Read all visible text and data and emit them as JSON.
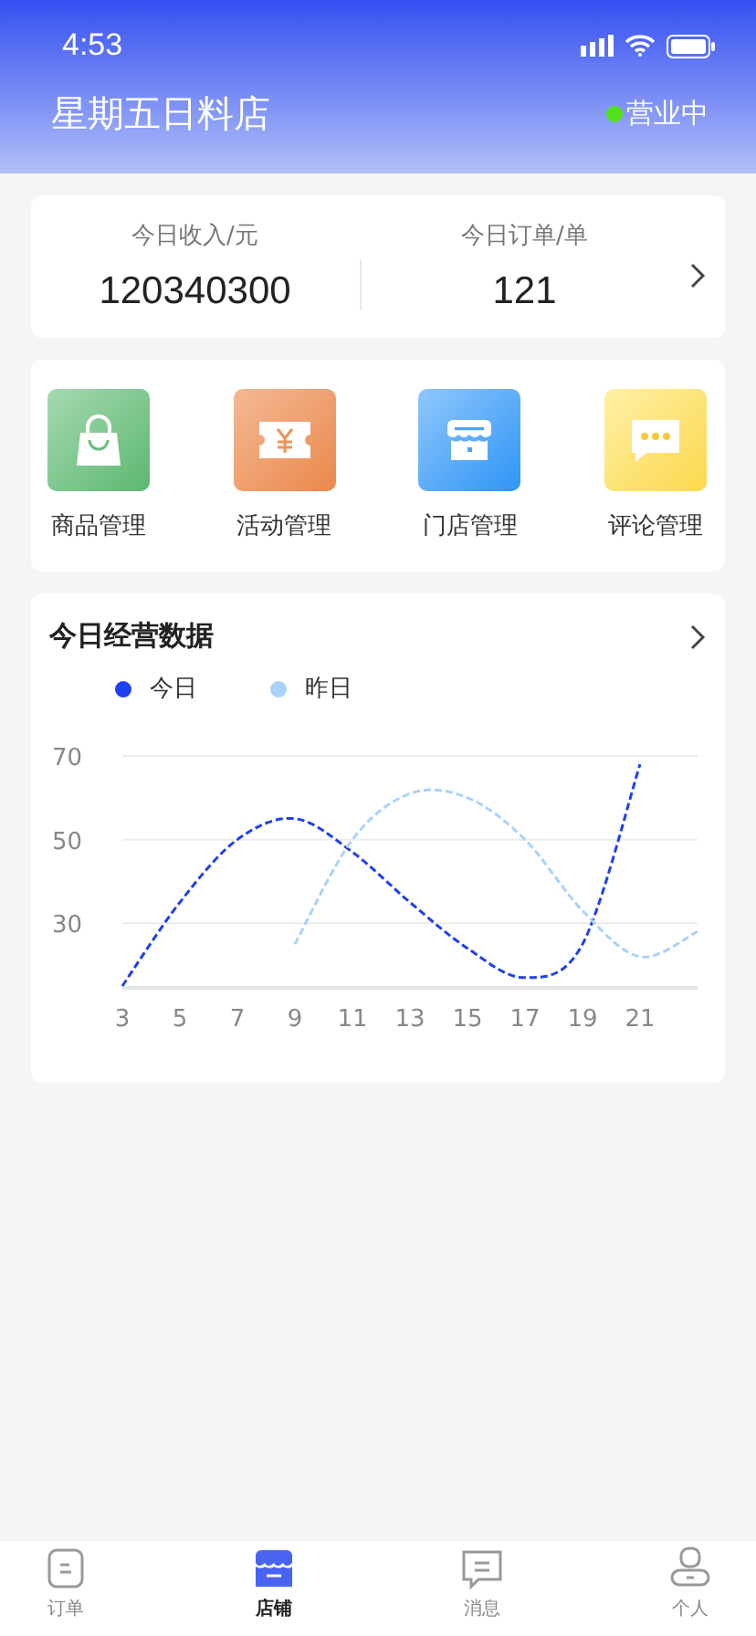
{
  "status_bar": {
    "time": "4:53"
  },
  "header": {
    "title": "星期五日料店",
    "status": {
      "label": "营业中",
      "color": "#52e01a"
    }
  },
  "stats": [
    {
      "label": "今日收入/元",
      "value": "120340300"
    },
    {
      "label": "今日订单/单",
      "value": "121"
    }
  ],
  "shortcuts": [
    {
      "label": "商品管理"
    },
    {
      "label": "活动管理"
    },
    {
      "label": "门店管理"
    },
    {
      "label": "评论管理"
    }
  ],
  "chart_section": {
    "title": "今日经营数据",
    "chart_data": {
      "type": "line",
      "x": [
        3,
        5,
        7,
        9,
        11,
        13,
        15,
        17,
        19,
        21,
        23
      ],
      "xlim": [
        3,
        23
      ],
      "ylim": [
        15,
        70
      ],
      "xticks": [
        3,
        5,
        7,
        9,
        11,
        13,
        15,
        17,
        19,
        21
      ],
      "yticks": [
        30,
        50,
        70
      ],
      "series": [
        {
          "name": "今日",
          "color": "#1f3ff0",
          "line_style": "dashed",
          "values": [
            15,
            35,
            50,
            55,
            47,
            35,
            24,
            17,
            25,
            68,
            null
          ]
        },
        {
          "name": "昨日",
          "color": "#a9d2fb",
          "line_style": "dashed",
          "values": [
            null,
            null,
            null,
            25,
            50,
            61,
            60,
            50,
            33,
            22,
            28
          ]
        }
      ]
    }
  },
  "tab_bar": [
    {
      "label": "订单",
      "selected": false
    },
    {
      "label": "店铺",
      "selected": true
    },
    {
      "label": "消息",
      "selected": false
    },
    {
      "label": "个人",
      "selected": false
    }
  ]
}
